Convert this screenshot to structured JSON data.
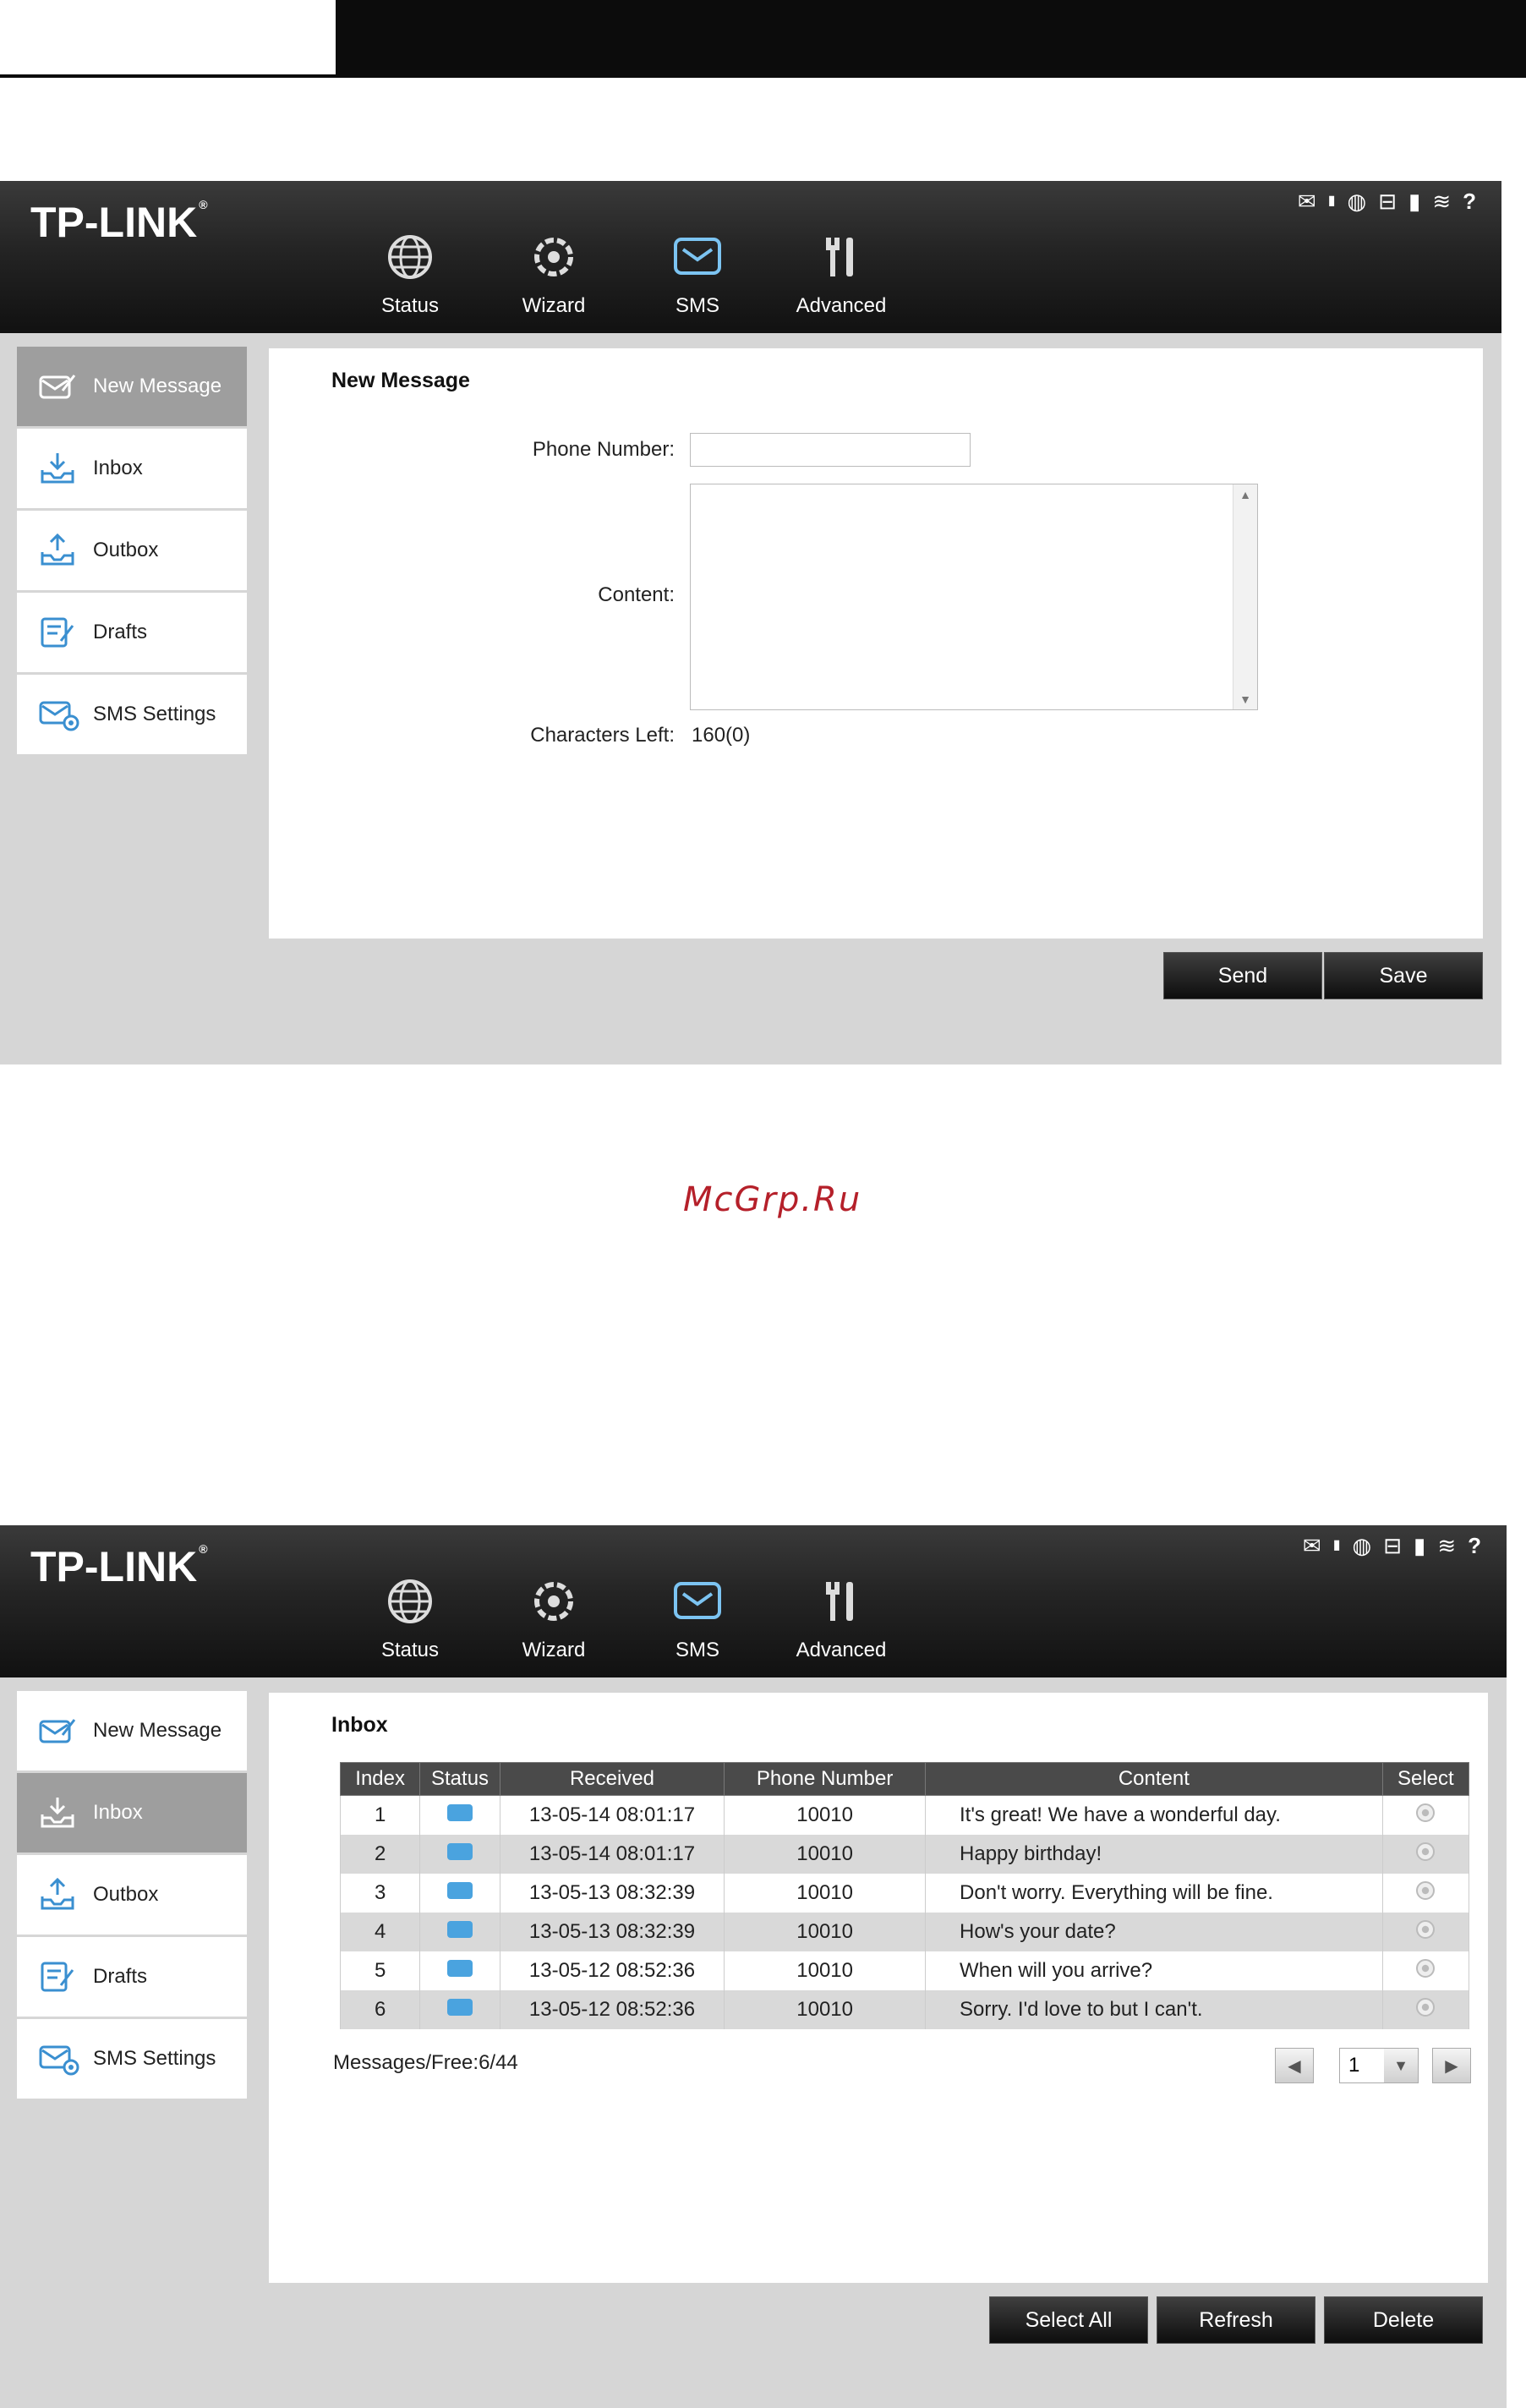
{
  "brand": "TP-LINK",
  "watermark": "McGrp.Ru",
  "nav": [
    "Status",
    "Wizard",
    "SMS",
    "Advanced"
  ],
  "sidebar": [
    "New Message",
    "Inbox",
    "Outbox",
    "Drafts",
    "SMS Settings"
  ],
  "new_message": {
    "title": "New Message",
    "phone_label": "Phone Number:",
    "phone_value": "",
    "content_label": "Content:",
    "content_value": "",
    "chars_label": "Characters Left:",
    "chars_value": "160(0)",
    "send": "Send",
    "save": "Save"
  },
  "inbox": {
    "title": "Inbox",
    "columns": [
      "Index",
      "Status",
      "Received",
      "Phone Number",
      "Content",
      "Select"
    ],
    "rows": [
      {
        "index": "1",
        "received": "13-05-14 08:01:17",
        "phone": "10010",
        "content": "It's great! We have a wonderful day."
      },
      {
        "index": "2",
        "received": "13-05-14 08:01:17",
        "phone": "10010",
        "content": "Happy birthday!"
      },
      {
        "index": "3",
        "received": "13-05-13 08:32:39",
        "phone": "10010",
        "content": "Don't worry. Everything will be fine."
      },
      {
        "index": "4",
        "received": "13-05-13 08:32:39",
        "phone": "10010",
        "content": "How's your date?"
      },
      {
        "index": "5",
        "received": "13-05-12 08:52:36",
        "phone": "10010",
        "content": "When will you arrive?"
      },
      {
        "index": "6",
        "received": "13-05-12 08:52:36",
        "phone": "10010",
        "content": "Sorry. I'd love to but I can't."
      }
    ],
    "messages_free": "Messages/Free:6/44",
    "page": "1",
    "select_all": "Select All",
    "refresh": "Refresh",
    "delete": "Delete"
  }
}
